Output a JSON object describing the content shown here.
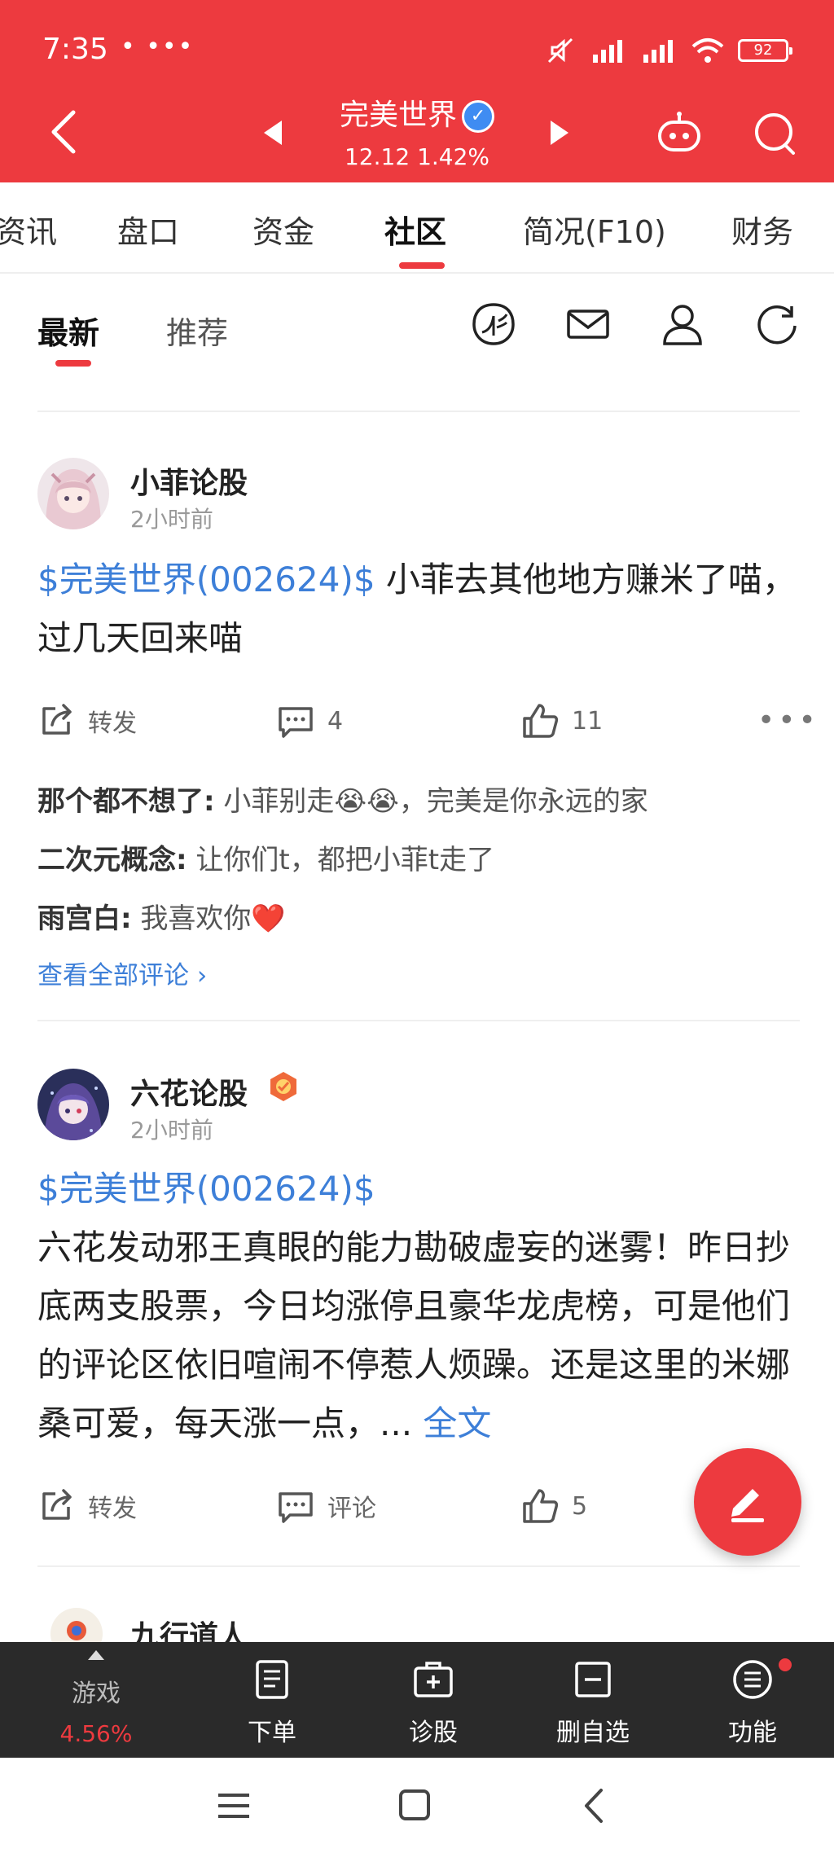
{
  "status_bar": {
    "time": "7:35",
    "dots": "• •••",
    "battery": "92"
  },
  "header": {
    "stock_name": "完美世界",
    "price": "12.12",
    "change_pct": "1.42%",
    "verified_mark": "✓",
    "accent_color": "#ed3a3f"
  },
  "main_tabs": [
    {
      "label": "资讯"
    },
    {
      "label": "盘口"
    },
    {
      "label": "资金"
    },
    {
      "label": "社区",
      "active": true
    },
    {
      "label": "简况(F10)"
    },
    {
      "label": "财务"
    }
  ],
  "sub_tabs": [
    {
      "label": "最新",
      "active": true
    },
    {
      "label": "推荐"
    }
  ],
  "toolbar_icons": [
    "leaf-badge-icon",
    "mail-icon",
    "user-icon",
    "refresh-icon"
  ],
  "posts": [
    {
      "author": "小菲论股",
      "time": "2小时前",
      "stock_tag": "$完美世界(002624)$",
      "text": " 小菲去其他地方赚米了喵，过几天回来喵",
      "repost_label": "转发",
      "comment_count": "4",
      "like_count": "11",
      "comments": [
        {
          "name": "那个都不想了:",
          "text": " 小菲别走😭😭，完美是你永远的家"
        },
        {
          "name": "二次元概念:",
          "text": " 让你们t，都把小菲t走了"
        },
        {
          "name": "雨宫白:",
          "text": " 我喜欢你❤️"
        }
      ],
      "view_all": "查看全部评论 ›"
    },
    {
      "author": "六花论股",
      "time": "2小时前",
      "stock_tag": "$完美世界(002624)$",
      "text": "六花发动邪王真眼的能力勘破虚妄的迷雾！昨日抄底两支股票，今日均涨停且豪华龙虎榜，可是他们的评论区依旧喧闹不停惹人烦躁。还是这里的米娜桑可爱，每天涨一点，... ",
      "full_text_link": "全文",
      "repost_label": "转发",
      "comment_label": "评论",
      "like_count": "5"
    },
    {
      "author": "九行道人"
    }
  ],
  "bottom_bar": {
    "game": {
      "label": "游戏",
      "pct": "4.56%"
    },
    "items": [
      {
        "label": "下单",
        "icon": "order-doc-icon"
      },
      {
        "label": "诊股",
        "icon": "diagnose-icon"
      },
      {
        "label": "删自选",
        "icon": "remove-watchlist-icon"
      },
      {
        "label": "功能",
        "icon": "menu-circle-icon"
      }
    ]
  }
}
